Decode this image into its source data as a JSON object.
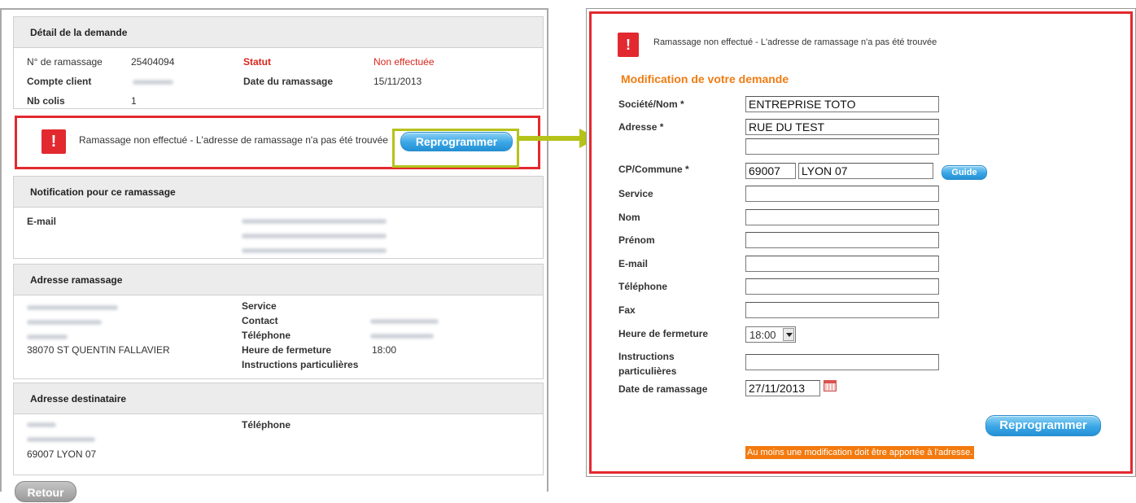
{
  "left": {
    "detail": {
      "title": "Détail de la demande",
      "rows": [
        {
          "label": "N° de ramassage",
          "value": "25404094"
        },
        {
          "label": "Compte client",
          "value": ""
        },
        {
          "label": "Nb colis",
          "value": "1"
        }
      ],
      "status_label": "Statut",
      "status_value": "Non effectuée",
      "date_label": "Date du ramassage",
      "date_value": "15/11/2013"
    },
    "alert": {
      "message": "Ramassage non effectué - L'adresse de ramassage n'a pas été trouvée",
      "button": "Reprogrammer",
      "icon": "!"
    },
    "notification": {
      "title": "Notification pour ce ramassage",
      "email_label": "E-mail"
    },
    "pickup_address": {
      "title": "Adresse ramassage",
      "city_line": "38070 ST QUENTIN FALLAVIER",
      "service_label": "Service",
      "contact_label": "Contact",
      "phone_label": "Téléphone",
      "closing_label": "Heure de fermeture",
      "closing_value": "18:00",
      "instructions_label": "Instructions particulières"
    },
    "recipient_address": {
      "title": "Adresse destinataire",
      "city_line": "69007 LYON 07",
      "phone_label": "Téléphone"
    },
    "back_button": "Retour"
  },
  "right": {
    "alert_message": "Ramassage non effectué - L'adresse de ramassage n'a pas été trouvée",
    "alert_icon": "!",
    "title": "Modification de votre demande",
    "fields": {
      "company_label": "Société/Nom *",
      "company_value": "ENTREPRISE TOTO",
      "address_label": "Adresse *",
      "address_value": "RUE DU TEST",
      "address2_value": "",
      "cp_label": "CP/Commune *",
      "cp_value": "69007",
      "city_value": "LYON 07",
      "guide_button": "Guide",
      "service_label": "Service",
      "nom_label": "Nom",
      "prenom_label": "Prénom",
      "email_label": "E-mail",
      "telephone_label": "Téléphone",
      "fax_label": "Fax",
      "closing_label": "Heure de fermeture",
      "closing_value": "18:00",
      "instructions_label_1": "Instructions",
      "instructions_label_2": "particulières",
      "date_label": "Date de ramassage",
      "date_value": "27/11/2013"
    },
    "submit_button": "Reprogrammer",
    "warning": "Au moins une modification doit être apportée à l'adresse."
  },
  "colors": {
    "alert_red": "#e2292f",
    "highlight_green": "#b5c21a",
    "orange": "#f07c12",
    "button_blue": "#3aa6e6"
  }
}
